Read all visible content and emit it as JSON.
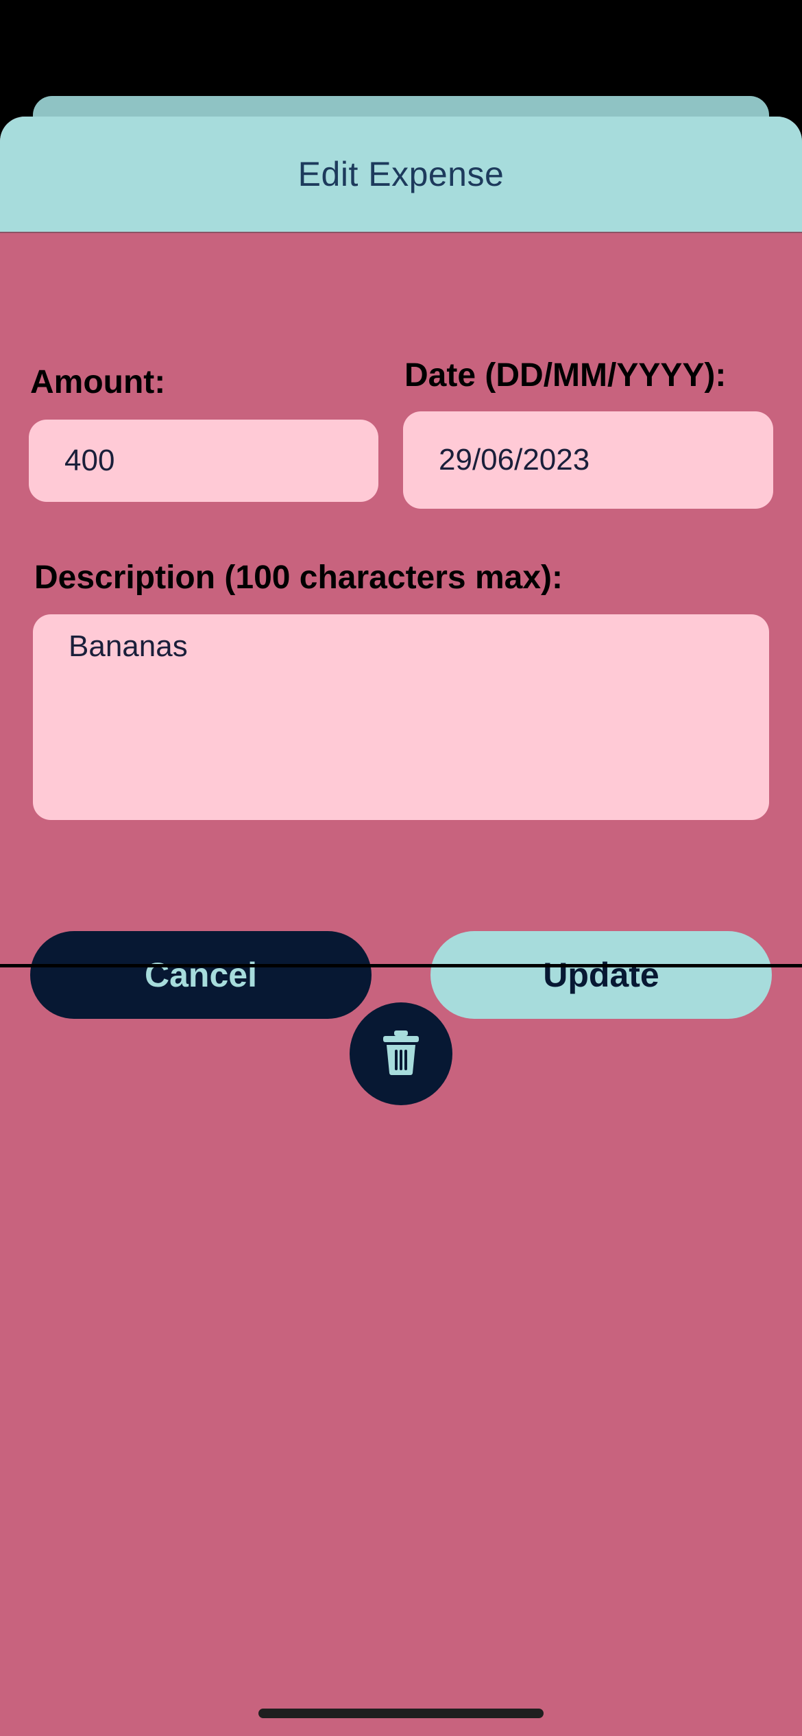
{
  "header": {
    "title": "Edit Expense"
  },
  "form": {
    "amount_label": "Amount:",
    "amount_value": "400",
    "date_label": "Date (DD/MM/YYYY):",
    "date_value": "29/06/2023",
    "description_label": "Description (100 characters max):",
    "description_value": "Bananas"
  },
  "actions": {
    "cancel_label": "Cancel",
    "update_label": "Update",
    "delete_icon": "trash-icon"
  },
  "colors": {
    "background": "#c8637e",
    "header": "#a7dcdc",
    "field": "#ffcad6",
    "dark": "#071833"
  }
}
